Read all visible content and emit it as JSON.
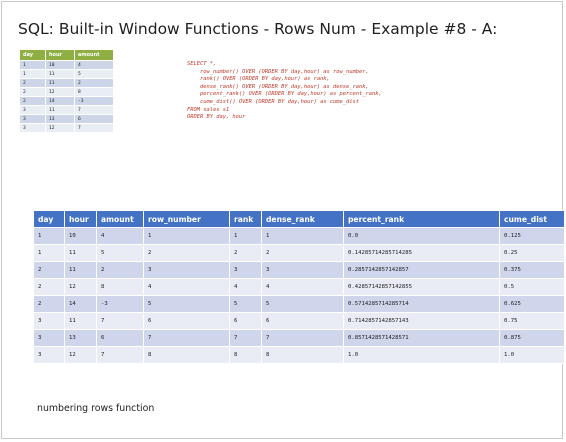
{
  "title": "SQL: Built-in Window Functions - Rows Num - Example #8 - A:",
  "source_table": {
    "headers": [
      "day",
      "hour",
      "amount"
    ],
    "rows": [
      [
        "1",
        "10",
        "4"
      ],
      [
        "1",
        "11",
        "5"
      ],
      [
        "2",
        "11",
        "2"
      ],
      [
        "2",
        "12",
        "8"
      ],
      [
        "2",
        "14",
        "-3"
      ],
      [
        "3",
        "11",
        "7"
      ],
      [
        "3",
        "13",
        "6"
      ],
      [
        "3",
        "12",
        "7"
      ]
    ],
    "header_color": "#8fae43",
    "row_color_odd": "#cdd6e9",
    "row_color_even": "#e9edf4"
  },
  "sql_lines": [
    "SELECT *,",
    "    row_number() OVER (ORDER BY day,hour) as row_number,",
    "    rank() OVER (ORDER BY day,hour) as rank,",
    "    dense_rank() OVER (ORDER BY day,hour) as dense_rank,",
    "    percent_rank() OVER (ORDER BY day,hour) as percent_rank,",
    "    cume_dist() OVER (ORDER BY day,hour) as cume_dist",
    "FROM sales s1",
    "ORDER BY day, hour"
  ],
  "sql_color": "#c0392b",
  "result_table": {
    "headers": [
      "day",
      "hour",
      "amount",
      "row_number",
      "rank",
      "dense_rank",
      "percent_rank",
      "cume_dist"
    ],
    "rows": [
      [
        "1",
        "10",
        "4",
        "1",
        "1",
        "1",
        "0.0",
        "0.125"
      ],
      [
        "1",
        "11",
        "5",
        "2",
        "2",
        "2",
        "0.14285714285714285",
        "0.25"
      ],
      [
        "2",
        "11",
        "2",
        "3",
        "3",
        "3",
        "0.2857142857142857",
        "0.375"
      ],
      [
        "2",
        "12",
        "8",
        "4",
        "4",
        "4",
        "0.42857142857142855",
        "0.5"
      ],
      [
        "2",
        "14",
        "-3",
        "5",
        "5",
        "5",
        "0.5714285714285714",
        "0.625"
      ],
      [
        "3",
        "11",
        "7",
        "6",
        "6",
        "6",
        "0.7142857142857143",
        "0.75"
      ],
      [
        "3",
        "13",
        "6",
        "7",
        "7",
        "7",
        "0.8571428571428571",
        "0.875"
      ],
      [
        "3",
        "12",
        "7",
        "8",
        "8",
        "8",
        "1.0",
        "1.0"
      ]
    ],
    "header_color": "#4472c4",
    "row_color_odd": "#cfd5ea",
    "row_color_even": "#e9ebf5"
  },
  "caption": "numbering rows function"
}
